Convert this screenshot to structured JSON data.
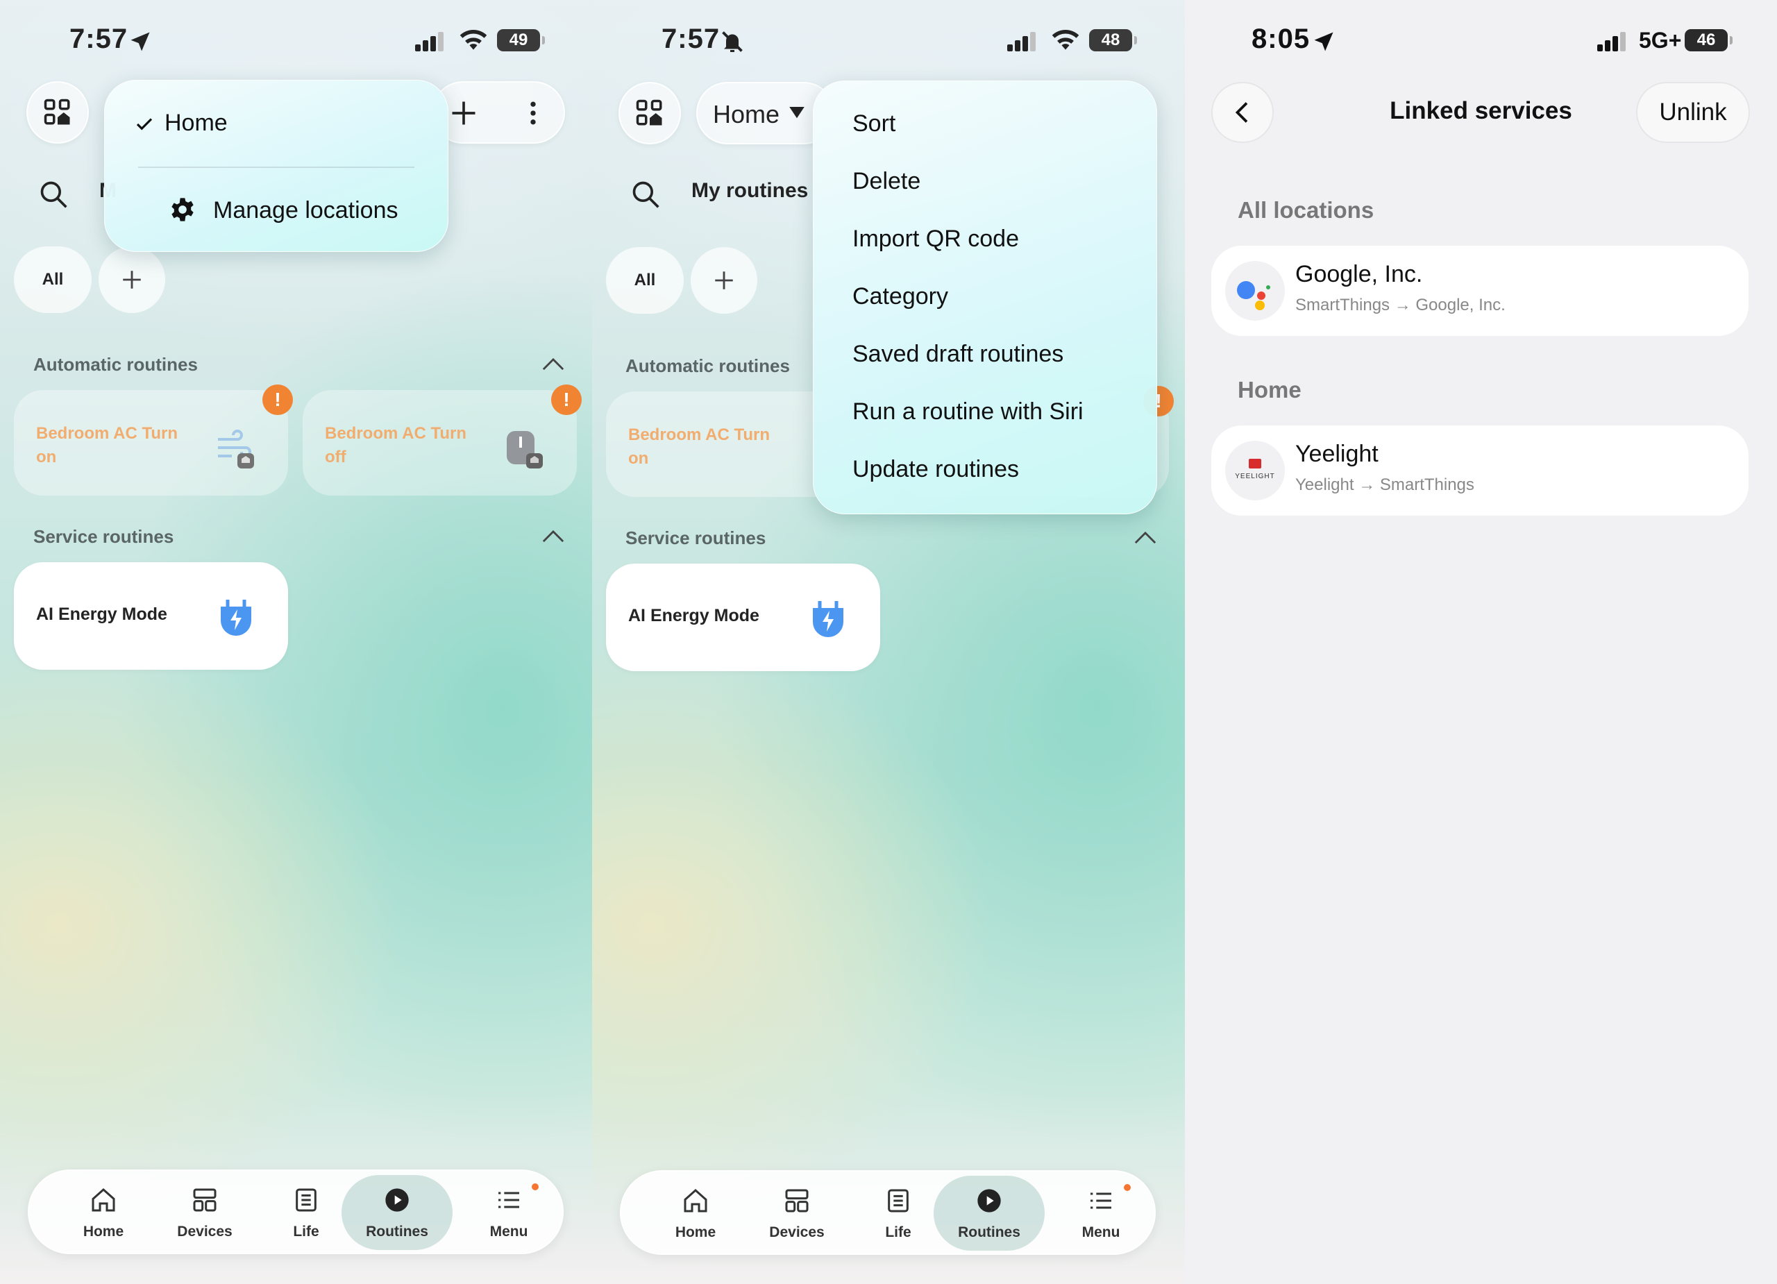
{
  "panels": {
    "p1": {
      "status": {
        "time": "7:57",
        "battery": "49"
      },
      "dropdown": {
        "selected": "Home",
        "manage": "Manage locations"
      },
      "search": {
        "partial": "M"
      },
      "chips": {
        "all": "All"
      },
      "sections": {
        "automatic": "Automatic routines",
        "service": "Service routines"
      },
      "cards": {
        "auto1": "Bedroom AC Turn on",
        "auto2": "Bedroom AC Turn off",
        "service1": "AI Energy Mode"
      },
      "alert_glyph": "!"
    },
    "p2": {
      "status": {
        "time": "7:57",
        "battery": "48"
      },
      "location": "Home",
      "search": {
        "label": "My routines"
      },
      "chips": {
        "all": "All"
      },
      "sections": {
        "automatic": "Automatic routines",
        "service": "Service routines"
      },
      "cards": {
        "auto1": "Bedroom AC Turn on",
        "service1": "AI Energy Mode"
      },
      "alert_glyph": "!",
      "menu": [
        "Sort",
        "Delete",
        "Import QR code",
        "Category",
        "Saved draft routines",
        "Run a routine with Siri",
        "Update routines"
      ]
    },
    "p3": {
      "status": {
        "time": "8:05",
        "network": "5G+",
        "battery": "46"
      },
      "title": "Linked services",
      "unlink": "Unlink",
      "groups": [
        {
          "title": "All locations",
          "name": "Google, Inc.",
          "sub": "SmartThings → Google, Inc.",
          "logo": "google-assistant-logo"
        },
        {
          "title": "Home",
          "name": "Yeelight",
          "sub": "Yeelight → SmartThings",
          "logo": "yeelight-logo",
          "logo_text": "YEELIGHT"
        }
      ]
    }
  },
  "tabbar": [
    "Home",
    "Devices",
    "Life",
    "Routines",
    "Menu"
  ],
  "colors": {
    "accent_orange": "#f07a22",
    "energy_blue": "#3b8ef0",
    "routine_text": "#f0a764"
  }
}
